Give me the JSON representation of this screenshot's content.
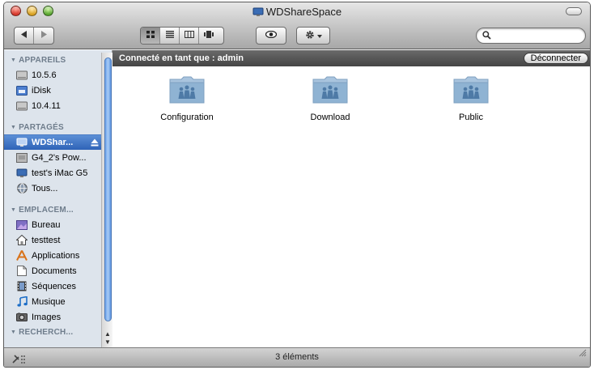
{
  "window": {
    "title": "WDShareSpace"
  },
  "toolbar": {
    "back_icon": "back-arrow-icon",
    "forward_icon": "forward-arrow-icon",
    "view_modes": [
      "icon-view-icon",
      "list-view-icon",
      "column-view-icon",
      "coverflow-view-icon"
    ],
    "active_view": 0,
    "quicklook_icon": "eye-icon",
    "action_icon": "gear-icon",
    "search_placeholder": ""
  },
  "sidebar": {
    "sections": [
      {
        "title": "APPAREILS",
        "items": [
          {
            "label": "10.5.6",
            "icon": "hard-disk-icon"
          },
          {
            "label": "iDisk",
            "icon": "idisk-icon"
          },
          {
            "label": "10.4.11",
            "icon": "hard-disk-icon"
          }
        ]
      },
      {
        "title": "PARTAGÉS",
        "items": [
          {
            "label": "WDShar...",
            "icon": "network-display-icon",
            "selected": true,
            "eject": true
          },
          {
            "label": "G4_2's Pow...",
            "icon": "computer-icon"
          },
          {
            "label": "test's iMac G5",
            "icon": "network-display-icon"
          },
          {
            "label": "Tous...",
            "icon": "globe-icon"
          }
        ]
      },
      {
        "title": "EMPLACEM...",
        "items": [
          {
            "label": "Bureau",
            "icon": "desktop-icon"
          },
          {
            "label": "testtest",
            "icon": "home-icon"
          },
          {
            "label": "Applications",
            "icon": "applications-icon"
          },
          {
            "label": "Documents",
            "icon": "documents-icon"
          },
          {
            "label": "Séquences",
            "icon": "movies-icon"
          },
          {
            "label": "Musique",
            "icon": "music-icon"
          },
          {
            "label": "Images",
            "icon": "pictures-icon"
          }
        ]
      },
      {
        "title": "RECHERCH...",
        "items": []
      }
    ]
  },
  "pathbar": {
    "connected_text": "Connecté en tant que : admin",
    "disconnect_label": "Déconnecter"
  },
  "content": {
    "folders": [
      {
        "name": "Configuration",
        "icon": "shared-folder-icon"
      },
      {
        "name": "Download",
        "icon": "shared-folder-icon"
      },
      {
        "name": "Public",
        "icon": "shared-folder-icon"
      }
    ]
  },
  "status": {
    "text": "3 éléments"
  },
  "colors": {
    "selection": "#3a6fc2",
    "folder_blue": "#8fb3d3",
    "pathbar": "#555555",
    "sidebar_bg": "#dde4ec"
  }
}
